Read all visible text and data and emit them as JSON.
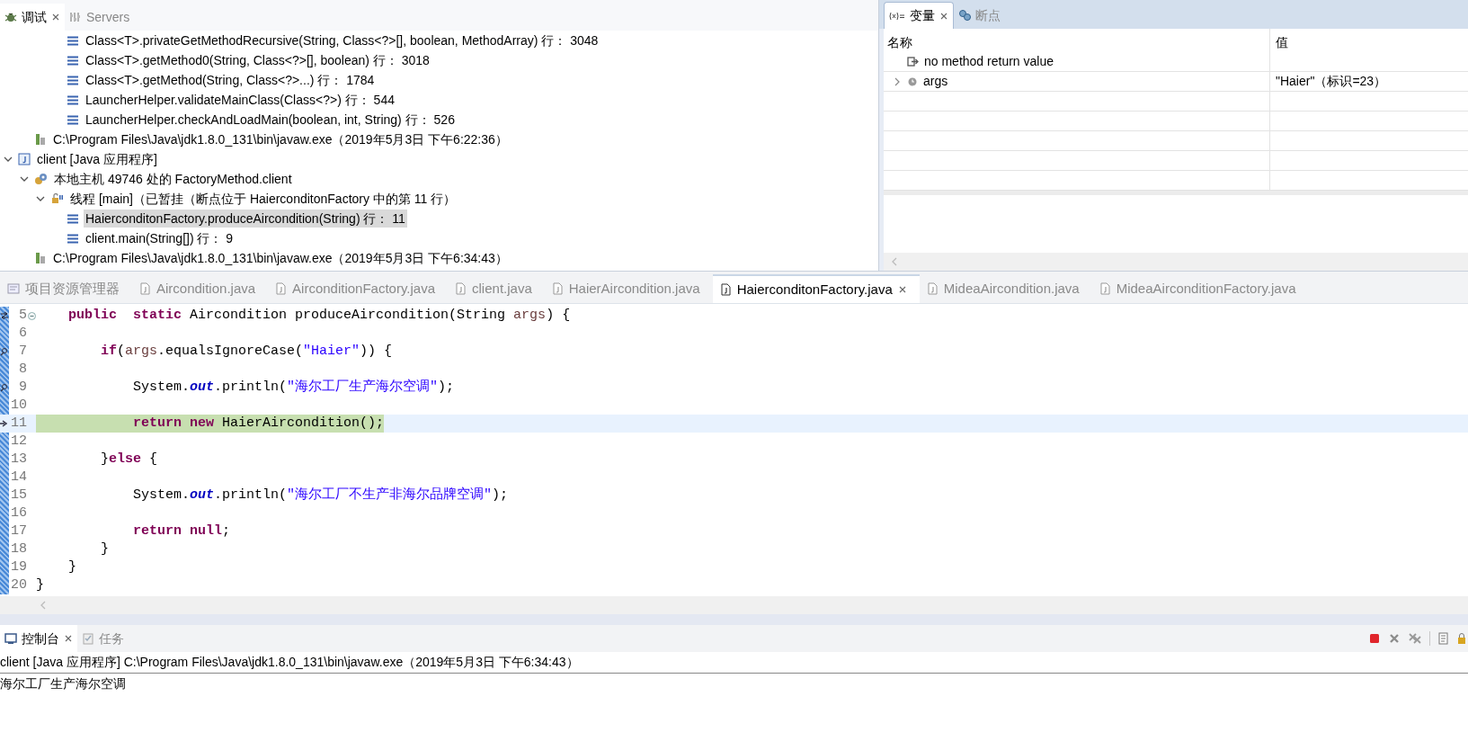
{
  "debug_view": {
    "tabs": [
      {
        "label": "调试",
        "selected": true
      },
      {
        "label": "Servers",
        "selected": false
      }
    ],
    "tree": [
      {
        "kind": "launch",
        "children": [
          {
            "kind": "target",
            "children": [
              {
                "kind": "thread",
                "children": [
                  {
                    "kind": "frame",
                    "label": "Class<T>.privateGetMethodRecursive(String, Class<?>[], boolean, MethodArray) 行： 3048",
                    "selected": false
                  },
                  {
                    "kind": "frame",
                    "label": "Class<T>.getMethod0(String, Class<?>[], boolean) 行： 3018",
                    "selected": false
                  },
                  {
                    "kind": "frame",
                    "label": "Class<T>.getMethod(String, Class<?>...) 行： 1784",
                    "selected": false
                  },
                  {
                    "kind": "frame",
                    "label": "LauncherHelper.validateMainClass(Class<?>) 行： 544",
                    "selected": false
                  },
                  {
                    "kind": "frame",
                    "label": "LauncherHelper.checkAndLoadMain(boolean, int, String) 行： 526",
                    "selected": false
                  }
                ]
              }
            ]
          },
          {
            "kind": "process",
            "label": "C:\\Program Files\\Java\\jdk1.8.0_131\\bin\\javaw.exe（2019年5月3日 下午6:22:36）"
          }
        ]
      },
      {
        "kind": "launch",
        "label": "client [Java 应用程序]",
        "expanded": true,
        "children": [
          {
            "kind": "target",
            "label": "本地主机 49746 处的 FactoryMethod.client",
            "expanded": true,
            "children": [
              {
                "kind": "thread",
                "label": "线程 [main]（已暂挂（断点位于 HaierconditonFactory 中的第 11 行）",
                "expanded": true,
                "children": [
                  {
                    "kind": "frame",
                    "label": "HaierconditonFactory.produceAircondition(String) 行： 11",
                    "selected": true
                  },
                  {
                    "kind": "frame",
                    "label": "client.main(String[]) 行： 9",
                    "selected": false
                  }
                ]
              }
            ]
          },
          {
            "kind": "process",
            "label": "C:\\Program Files\\Java\\jdk1.8.0_131\\bin\\javaw.exe（2019年5月3日 下午6:34:43）"
          }
        ]
      }
    ]
  },
  "variables_view": {
    "tabs": [
      {
        "label": "变量",
        "selected": true
      },
      {
        "label": "断点",
        "selected": false
      }
    ],
    "columns": [
      "名称",
      "值"
    ],
    "rows": [
      {
        "kind": "return",
        "name": "no method return value"
      },
      {
        "kind": "variable",
        "name": "args",
        "value": "\"Haier\"（标识=23）",
        "expanded": false
      }
    ]
  },
  "editor": {
    "tabs": [
      {
        "kind": "view",
        "label": "项目资源管理器",
        "selected": false
      },
      {
        "kind": "file",
        "label": "Aircondition.java",
        "selected": false
      },
      {
        "kind": "file",
        "label": "AirconditionFactory.java",
        "selected": false
      },
      {
        "kind": "file",
        "label": "client.java",
        "selected": false
      },
      {
        "kind": "file",
        "label": "HaierAircondition.java",
        "selected": false
      },
      {
        "kind": "file",
        "label": "HaierconditonFactory.java",
        "selected": true
      },
      {
        "kind": "file",
        "label": "MideaAircondition.java",
        "selected": false
      },
      {
        "kind": "file",
        "label": "MideaAirconditionFactory.java",
        "selected": false
      }
    ],
    "lines": [
      {
        "number": "5",
        "kind": "override",
        "foldable": true,
        "current": false,
        "tokens": [
          {
            "kind": "keyword",
            "text": "    public  "
          },
          {
            "kind": "keyword",
            "text": "static"
          },
          {
            "kind": "plain",
            "text": " Aircondition produceAircondition(String "
          },
          {
            "kind": "param",
            "text": "args"
          },
          {
            "kind": "plain",
            "text": ") {"
          }
        ]
      },
      {
        "number": "6",
        "kind": "plain",
        "foldable": false,
        "current": false
      },
      {
        "number": "7",
        "kind": "link",
        "foldable": false,
        "current": false,
        "tokens": [
          {
            "kind": "keyword",
            "text": "        if"
          },
          {
            "kind": "plain",
            "text": "("
          },
          {
            "kind": "param",
            "text": "args"
          },
          {
            "kind": "plain",
            "text": ".equalsIgnoreCase("
          },
          {
            "kind": "string",
            "text": "\"Haier\""
          },
          {
            "kind": "plain",
            "text": ")) {"
          }
        ]
      },
      {
        "number": "8",
        "kind": "plain",
        "foldable": false,
        "current": false
      },
      {
        "number": "9",
        "kind": "link",
        "foldable": false,
        "current": false,
        "tokens": [
          {
            "kind": "plain",
            "text": "            System."
          },
          {
            "kind": "field",
            "text": "out"
          },
          {
            "kind": "plain",
            "text": ".println("
          },
          {
            "kind": "string",
            "text": "\"海尔工厂生产海尔空调\""
          },
          {
            "kind": "plain",
            "text": ");"
          }
        ]
      },
      {
        "number": "10",
        "kind": "plain",
        "foldable": false,
        "current": false
      },
      {
        "number": "11",
        "kind": "instruction",
        "foldable": false,
        "current": true,
        "tokens": [
          {
            "kind": "keyword",
            "text": "            return new"
          },
          {
            "kind": "plain",
            "text": " HaierAircondition();"
          }
        ]
      },
      {
        "number": "12",
        "kind": "plain",
        "foldable": false,
        "current": false
      },
      {
        "number": "13",
        "kind": "plain",
        "foldable": false,
        "current": false,
        "tokens": [
          {
            "kind": "plain",
            "text": "        }"
          },
          {
            "kind": "keyword",
            "text": "else"
          },
          {
            "kind": "plain",
            "text": " {"
          }
        ]
      },
      {
        "number": "14",
        "kind": "plain",
        "foldable": false,
        "current": false
      },
      {
        "number": "15",
        "kind": "plain",
        "foldable": false,
        "current": false,
        "tokens": [
          {
            "kind": "plain",
            "text": "            System."
          },
          {
            "kind": "field",
            "text": "out"
          },
          {
            "kind": "plain",
            "text": ".println("
          },
          {
            "kind": "string",
            "text": "\"海尔工厂不生产非海尔品牌空调\""
          },
          {
            "kind": "plain",
            "text": ");"
          }
        ]
      },
      {
        "number": "16",
        "kind": "plain",
        "foldable": false,
        "current": false
      },
      {
        "number": "17",
        "kind": "plain",
        "foldable": false,
        "current": false,
        "tokens": [
          {
            "kind": "keyword",
            "text": "            return null"
          },
          {
            "kind": "plain",
            "text": ";"
          }
        ]
      },
      {
        "number": "18",
        "kind": "plain",
        "foldable": false,
        "current": false,
        "tokens": [
          {
            "kind": "plain",
            "text": "        }"
          }
        ]
      },
      {
        "number": "19",
        "kind": "plain",
        "foldable": false,
        "current": false,
        "tokens": [
          {
            "kind": "plain",
            "text": "    }"
          }
        ]
      },
      {
        "number": "20",
        "kind": "plain",
        "foldable": false,
        "current": false,
        "tokens": [
          {
            "kind": "plain",
            "text": "}"
          }
        ]
      }
    ]
  },
  "console": {
    "tabs": [
      {
        "label": "控制台",
        "selected": true
      },
      {
        "label": "任务",
        "selected": false
      }
    ],
    "header": "client [Java 应用程序] C:\\Program Files\\Java\\jdk1.8.0_131\\bin\\javaw.exe（2019年5月3日 下午6:34:43）",
    "output": [
      "海尔工厂生产海尔空调"
    ]
  }
}
